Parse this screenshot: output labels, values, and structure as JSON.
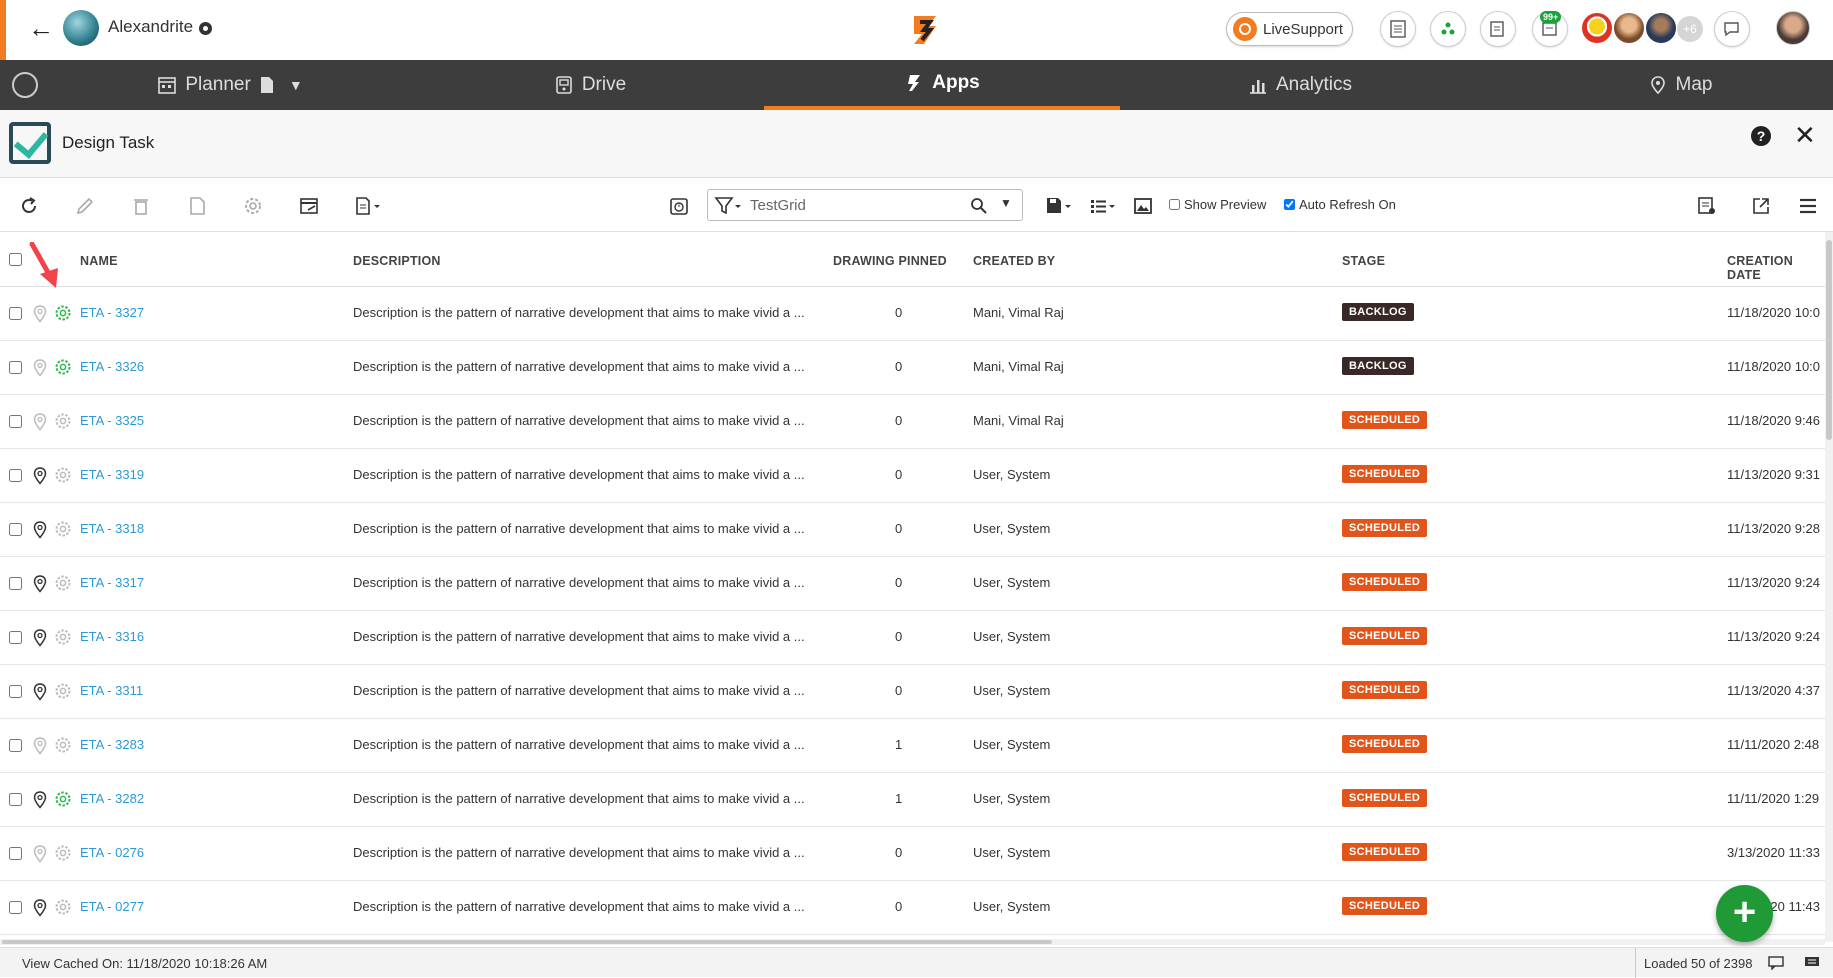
{
  "topbar": {
    "project_name": "Alexandrite",
    "live_support_label": "LiveSupport",
    "notification_badge": "99+",
    "more_users": "+6"
  },
  "nav": {
    "tabs": [
      {
        "label": "Planner"
      },
      {
        "label": "Drive"
      },
      {
        "label": "Apps"
      },
      {
        "label": "Analytics"
      },
      {
        "label": "Map"
      }
    ]
  },
  "app": {
    "title": "Design Task",
    "help": "?"
  },
  "toolbar": {
    "search_value": "TestGrid",
    "show_preview_label": "Show Preview",
    "auto_refresh_label": "Auto Refresh On"
  },
  "grid": {
    "headers": {
      "name": "NAME",
      "description": "DESCRIPTION",
      "drawing_pinned": "DRAWING PINNED",
      "created_by": "CREATED BY",
      "stage": "STAGE",
      "creation_date": "CREATION DATE"
    },
    "rows": [
      {
        "name": "ETA - 3327",
        "description": "Description is the pattern of narrative development that aims to make vivid a ...",
        "pinned": "0",
        "created_by": "Mani, Vimal Raj",
        "stage": "BACKLOG",
        "date": "11/18/2020 10:0"
      },
      {
        "name": "ETA - 3326",
        "description": "Description is the pattern of narrative development that aims to make vivid a ...",
        "pinned": "0",
        "created_by": "Mani, Vimal Raj",
        "stage": "BACKLOG",
        "date": "11/18/2020 10:0"
      },
      {
        "name": "ETA - 3325",
        "description": "Description is the pattern of narrative development that aims to make vivid a ...",
        "pinned": "0",
        "created_by": "Mani, Vimal Raj",
        "stage": "SCHEDULED",
        "date": "11/18/2020 9:46"
      },
      {
        "name": "ETA - 3319",
        "description": "Description is the pattern of narrative development that aims to make vivid a ...",
        "pinned": "0",
        "created_by": "User, System",
        "stage": "SCHEDULED",
        "date": "11/13/2020 9:31"
      },
      {
        "name": "ETA - 3318",
        "description": "Description is the pattern of narrative development that aims to make vivid a ...",
        "pinned": "0",
        "created_by": "User, System",
        "stage": "SCHEDULED",
        "date": "11/13/2020 9:28"
      },
      {
        "name": "ETA - 3317",
        "description": "Description is the pattern of narrative development that aims to make vivid a ...",
        "pinned": "0",
        "created_by": "User, System",
        "stage": "SCHEDULED",
        "date": "11/13/2020 9:24"
      },
      {
        "name": "ETA - 3316",
        "description": "Description is the pattern of narrative development that aims to make vivid a ...",
        "pinned": "0",
        "created_by": "User, System",
        "stage": "SCHEDULED",
        "date": "11/13/2020 9:24"
      },
      {
        "name": "ETA - 3311",
        "description": "Description is the pattern of narrative development that aims to make vivid a ...",
        "pinned": "0",
        "created_by": "User, System",
        "stage": "SCHEDULED",
        "date": "11/13/2020 4:37"
      },
      {
        "name": "ETA - 3283",
        "description": "Description is the pattern of narrative development that aims to make vivid a ...",
        "pinned": "1",
        "created_by": "User, System",
        "stage": "SCHEDULED",
        "date": "11/11/2020 2:48"
      },
      {
        "name": "ETA - 3282",
        "description": "Description is the pattern of narrative development that aims to make vivid a ...",
        "pinned": "1",
        "created_by": "User, System",
        "stage": "SCHEDULED",
        "date": "11/11/2020 1:29"
      },
      {
        "name": "ETA - 0276",
        "description": "Description is the pattern of narrative development that aims to make vivid a ...",
        "pinned": "0",
        "created_by": "User, System",
        "stage": "SCHEDULED",
        "date": "3/13/2020 11:33"
      },
      {
        "name": "ETA - 0277",
        "description": "Description is the pattern of narrative development that aims to make vivid a ...",
        "pinned": "0",
        "created_by": "User, System",
        "stage": "SCHEDULED",
        "date": "3/13/2020 11:43"
      }
    ]
  },
  "footer": {
    "cached": "View Cached On: 11/18/2020 10:18:26 AM",
    "loaded": "Loaded 50 of 2398"
  },
  "colors": {
    "accent": "#f47c20",
    "nav_bg": "#3d3d3d",
    "link": "#2b9ad6",
    "backlog": "#3a2826",
    "scheduled": "#e2551a",
    "fab": "#1f9a37"
  }
}
